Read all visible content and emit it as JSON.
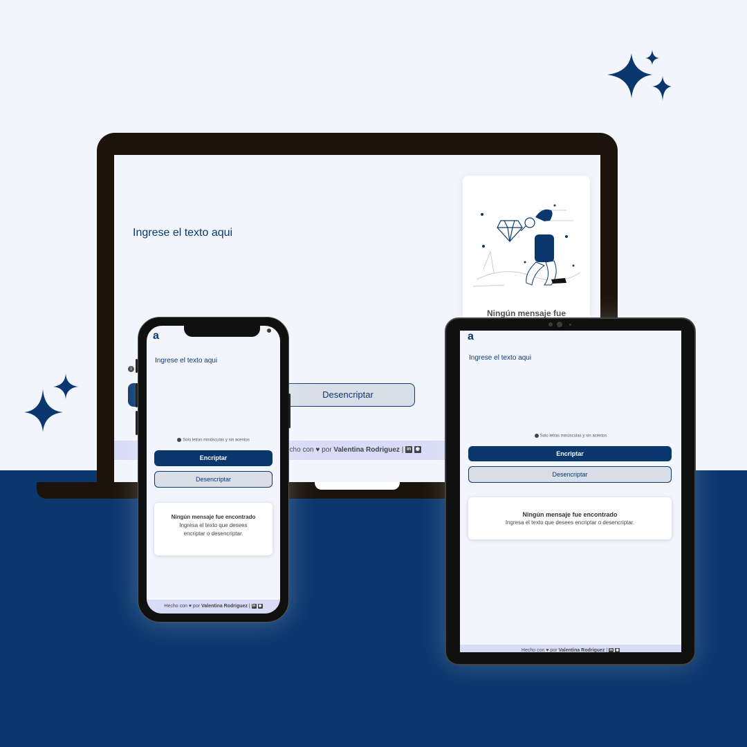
{
  "app": {
    "logo_text": "a",
    "prompt_placeholder": "Ingrese el texto aqui",
    "hint": "Solo letras minúsculas y sin acentos",
    "encrypt_label": "Encriptar",
    "decrypt_label": "Desencriptar",
    "empty_title": "Ningún mensaje fue encontrado",
    "empty_body": "Ingresa el texto que desees encriptar o desencriptar.",
    "empty_title_partial": "Ningún mensaje fue",
    "footer": {
      "made_with": "Hecho con",
      "made_with_partial": "echo con",
      "by": "por",
      "author": "Valentina Rodriguez",
      "separator": "|",
      "icons": [
        "linkedin-icon",
        "github-icon"
      ]
    }
  },
  "colors": {
    "primary": "#0a376e",
    "page_bg": "#f2f5fc",
    "footer_bg": "#d8dcf6",
    "button_secondary_bg": "#d8dee8"
  }
}
